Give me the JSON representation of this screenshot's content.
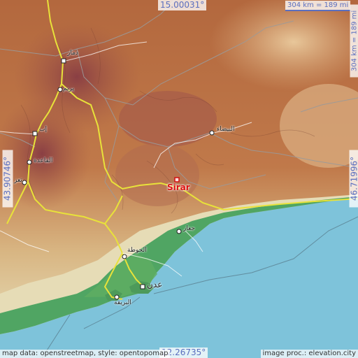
{
  "coordinates": {
    "top": "15.00031°",
    "bottom": "12.26735°",
    "left": "43.90746°",
    "right": "46.71996°"
  },
  "scale": {
    "horizontal": "304 km = 189 mi",
    "vertical": "304 km = 189 mi"
  },
  "credits": {
    "left": "map data: openstreetmap, style: opentopomap",
    "right": "image proc.: elevation.city"
  },
  "focus_place": "Sirar",
  "cities": {
    "dhamar": "ذمار",
    "yarim": "يريم",
    "ibb": "إب",
    "al_qaidah": "القاعدة",
    "taizz": "تعز",
    "al_bayda": "البيضاء",
    "jaar": "جعار",
    "al_hawtah": "الحوطة",
    "aden": "عدن",
    "al_burayqah": "البريقة"
  },
  "colors": {
    "sea": "#7ec3da",
    "lowland": "#3f9e5a",
    "plain": "#e9e0b8",
    "mountain": "#b8683f",
    "highland": "#8f4c45",
    "road": "#e8e23a",
    "border": "#9a9a9a",
    "focus_marker": "#d11111",
    "label": "#5b6fbf"
  }
}
